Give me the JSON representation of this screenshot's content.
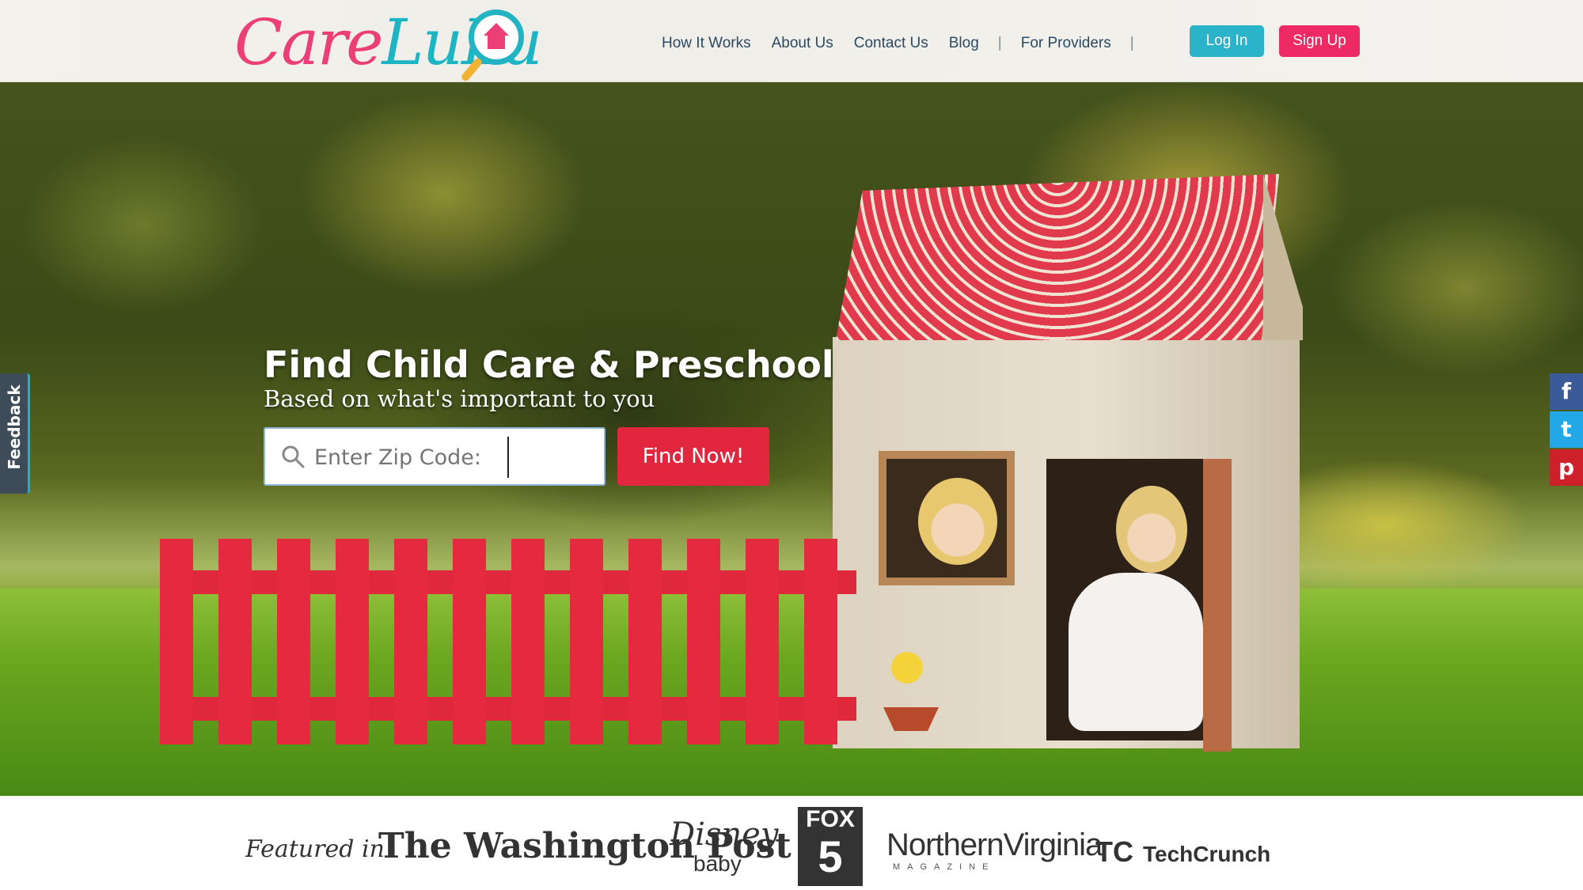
{
  "header": {
    "logo": "CareLuLu",
    "nav": [
      "How It Works",
      "About Us",
      "Contact Us",
      "Blog",
      "For Providers"
    ],
    "login_label": "Log In",
    "signup_label": "Sign Up"
  },
  "hero": {
    "title": "Find Child Care & Preschool",
    "subtitle": "Based on what's important to you",
    "zip_placeholder": "Enter Zip Code:",
    "find_label": "Find Now!"
  },
  "feedback_label": "Feedback",
  "social": [
    "facebook-icon",
    "twitter-icon",
    "pinterest-icon"
  ],
  "featured": {
    "label": "Featured in",
    "logos": [
      "The Washington Post",
      "Disney",
      "baby",
      "FOX",
      "5",
      "NorthernVirginia",
      "MAGAZINE",
      "TechCrunch"
    ]
  },
  "colors": {
    "brand_pink": "#ed2a64",
    "brand_teal": "#2ab3c9",
    "cta_red": "#e1263d"
  }
}
